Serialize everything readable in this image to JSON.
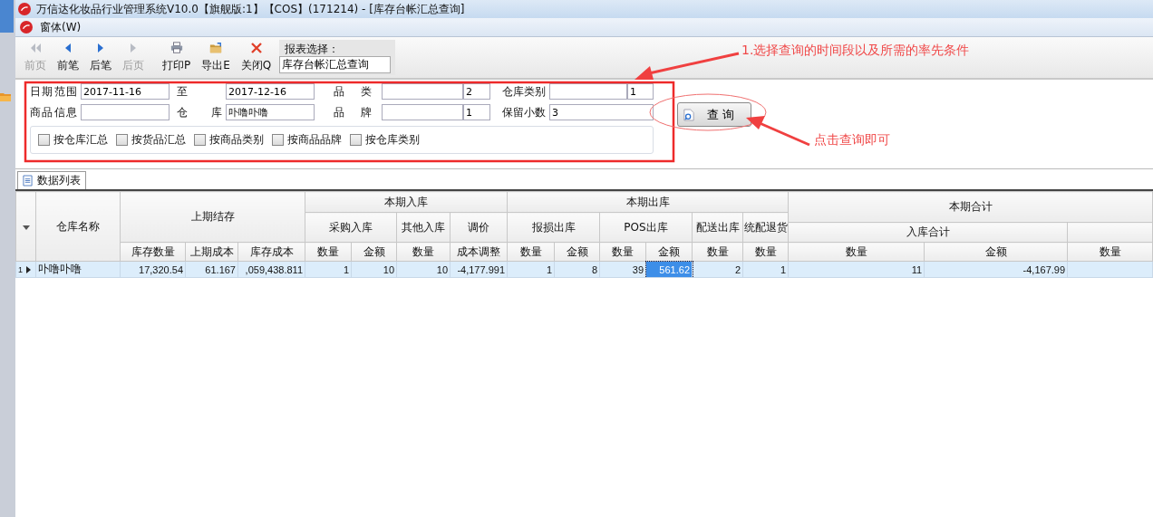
{
  "window": {
    "title": "万信达化妆品行业管理系统V10.0【旗舰版:1】【COS】(171214) - [库存台帐汇总查询]"
  },
  "menu": [
    {
      "label": "窗体(W)"
    }
  ],
  "toolbar": {
    "buttons": [
      {
        "label": "前页",
        "kind": "first",
        "disabled": true
      },
      {
        "label": "前笔",
        "kind": "prev",
        "disabled": false
      },
      {
        "label": "后笔",
        "kind": "next",
        "disabled": false
      },
      {
        "label": "后页",
        "kind": "last",
        "disabled": true
      },
      {
        "label": "打印P",
        "kind": "print",
        "disabled": false
      },
      {
        "label": "导出E",
        "kind": "export",
        "disabled": false
      },
      {
        "label": "关闭Q",
        "kind": "close",
        "disabled": false
      }
    ],
    "report_label": "报表选择：",
    "report_value": "库存台帐汇总查询"
  },
  "filters": {
    "fields": [
      {
        "label": "日期范围",
        "kind": "text",
        "value": "2017-11-16"
      },
      {
        "label": "至",
        "kind": "text",
        "value": "2017-12-16"
      },
      {
        "label": "品 类",
        "kind": "coded",
        "code": "2"
      },
      {
        "label": "仓库类别",
        "kind": "coded",
        "code": "1"
      },
      {
        "label": "商品信息",
        "kind": "text"
      },
      {
        "label": "仓 库",
        "kind": "text",
        "value": "卟噜卟噜"
      },
      {
        "label": "品 牌",
        "kind": "coded",
        "code": "1"
      },
      {
        "label": "保留小数",
        "kind": "text",
        "value": "3"
      }
    ],
    "checkboxes": [
      {
        "label": "按仓库汇总",
        "checked": false
      },
      {
        "label": "按货品汇总",
        "checked": false
      },
      {
        "label": "按商品类别",
        "checked": false
      },
      {
        "label": "按商品品牌",
        "checked": false
      },
      {
        "label": "按仓库类别",
        "checked": false
      }
    ],
    "query_button": "查 询"
  },
  "annotations": [
    {
      "text": "1.选择查询的时间段以及所需的率先条件"
    },
    {
      "text": "点击查询即可"
    }
  ],
  "tab": {
    "label": "数据列表",
    "selected": true
  },
  "table": {
    "header_rows": [
      [
        {
          "kind": "sort"
        },
        {
          "kind": "text",
          "text": "仓库名称"
        },
        {
          "kind": "text",
          "text": "上期结存"
        },
        {
          "kind": "text",
          "text": "本期入库"
        },
        {
          "kind": "text",
          "text": "本期出库"
        },
        {
          "kind": "text",
          "text": "本期合计"
        }
      ],
      [
        {
          "kind": "text",
          "text": "采购入库"
        },
        {
          "kind": "text",
          "text": "其他入库"
        },
        {
          "kind": "text",
          "text": "调价"
        },
        {
          "kind": "text",
          "text": "报损出库"
        },
        {
          "kind": "text",
          "text": "POS出库"
        },
        {
          "kind": "text",
          "text": "配送出库"
        },
        {
          "kind": "text",
          "text": "统配退货"
        }
      ],
      [
        {
          "kind": "text",
          "text": "入库合计"
        },
        {
          "kind": "blank"
        }
      ],
      [
        {
          "text": "库存数量"
        },
        {
          "text": "上期成本"
        },
        {
          "text": "库存成本"
        },
        {
          "text": "数量"
        },
        {
          "text": "金额"
        },
        {
          "text": "数量"
        },
        {
          "text": "成本调整"
        },
        {
          "text": "数量"
        },
        {
          "text": "金额"
        },
        {
          "text": "数量"
        },
        {
          "text": "金额"
        },
        {
          "text": "数量"
        },
        {
          "text": "数量"
        },
        {
          "text": "数量"
        },
        {
          "text": "金额"
        },
        {
          "text": "数量"
        }
      ]
    ],
    "rows": [
      {
        "number": "1",
        "selected": true,
        "cells": [
          {
            "text": "卟噜卟噜",
            "selected": false
          },
          {
            "text": "17,320.54",
            "selected": false
          },
          {
            "text": "61.167",
            "selected": false
          },
          {
            "text": ",059,438.811",
            "selected": false
          },
          {
            "text": "1",
            "selected": false
          },
          {
            "text": "10",
            "selected": false
          },
          {
            "text": "10",
            "selected": false
          },
          {
            "text": "-4,177.991",
            "selected": false
          },
          {
            "text": "1",
            "selected": false
          },
          {
            "text": "8",
            "selected": false
          },
          {
            "text": "39",
            "selected": false
          },
          {
            "text": "561.62",
            "selected": true
          },
          {
            "text": "2",
            "selected": false
          },
          {
            "text": "1",
            "selected": false
          },
          {
            "text": "11",
            "selected": false
          },
          {
            "text": "-4,167.99",
            "selected": false
          },
          {
            "selected": false
          }
        ]
      }
    ]
  }
}
